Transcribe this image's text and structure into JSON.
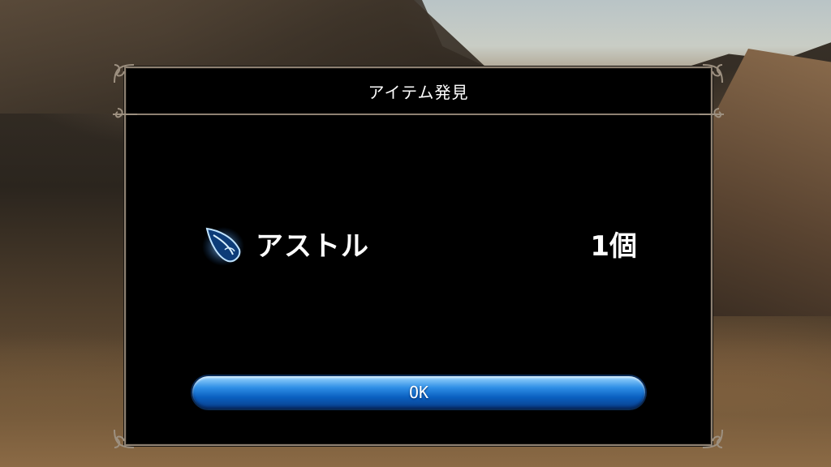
{
  "dialog": {
    "title": "アイテム発見",
    "item": {
      "icon": "crystal-shard-icon",
      "name": "アストル",
      "count": "1個"
    },
    "ok_label": "OK"
  },
  "colors": {
    "frame": "#8e8172",
    "button_blue": "#1f7fe0"
  }
}
